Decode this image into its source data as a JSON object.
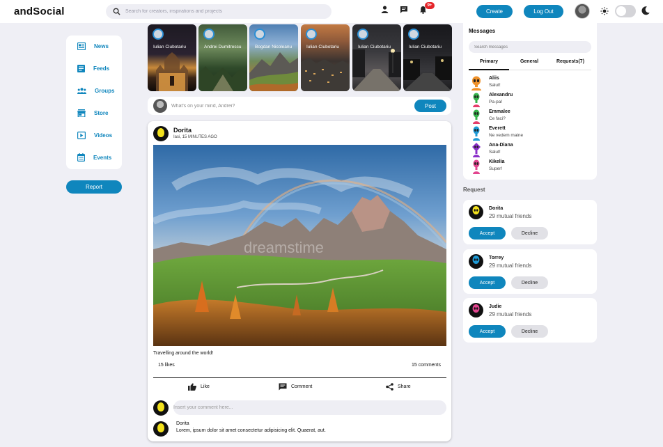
{
  "app": {
    "logo": "andSocial"
  },
  "search": {
    "placeholder": "Search for creators, inspirations and projects"
  },
  "header": {
    "notification_badge": "9+",
    "create_label": "Create",
    "logout_label": "Log Out"
  },
  "nav": {
    "items": [
      {
        "label": "News",
        "icon": "news-icon"
      },
      {
        "label": "Feeds",
        "icon": "feeds-icon"
      },
      {
        "label": "Groups",
        "icon": "groups-icon"
      },
      {
        "label": "Store",
        "icon": "store-icon"
      },
      {
        "label": "Videos",
        "icon": "videos-icon"
      },
      {
        "label": "Events",
        "icon": "events-icon"
      }
    ],
    "report_label": "Report"
  },
  "stories": [
    {
      "name": "Iulian Ciubotariu"
    },
    {
      "name": "Andrei Dumitrescu"
    },
    {
      "name": "Bogdan Nicoleanu"
    },
    {
      "name": "Iulian Ciubotariu"
    },
    {
      "name": "Iulian Ciubotariu"
    },
    {
      "name": "Iulian Ciubotariu"
    }
  ],
  "composer": {
    "placeholder": "What's on your mind, Andrei?",
    "post_label": "Post"
  },
  "post": {
    "author": "Dorita",
    "location": "Iasi, 15 MINUTES AGO",
    "watermark": "dreamstime",
    "caption": "Travelling around the world!",
    "likes": "15 likes",
    "comments": "15 comments",
    "actions": {
      "like": "Like",
      "comment": "Comment",
      "share": "Share"
    },
    "comment_placeholder": "Insert your comment here...",
    "comment": {
      "author": "Dorita",
      "text": "Lorem, ipsum dolor sit amet consectetur adipisicing elit. Quaerat, aut."
    }
  },
  "messages": {
    "title": "Messages",
    "search_placeholder": "Search messages",
    "tabs": [
      "Primary",
      "General",
      "Requests(7)"
    ],
    "list": [
      {
        "name": "Aliis",
        "text": "Salut!",
        "color": "#f0922a"
      },
      {
        "name": "Alexandru",
        "text": "Pa-pa!",
        "color": "#34b34a"
      },
      {
        "name": "Emmalee",
        "text": "Ce faci?",
        "color": "#e53d6b"
      },
      {
        "name": "Everett",
        "text": "Ne vedem maine",
        "color": "#1e9ad6"
      },
      {
        "name": "Ana-Diana",
        "text": "Salut!",
        "color": "#8b2fc9"
      },
      {
        "name": "Kikelia",
        "text": "Super!",
        "color": "#e2458f"
      }
    ]
  },
  "requests": {
    "title": "Request",
    "accept_label": "Accept",
    "decline_label": "Decline",
    "items": [
      {
        "name": "Dorita",
        "mutual": "29 mutual friends",
        "color": "#f2e11d"
      },
      {
        "name": "Torrey",
        "mutual": "29 mutual friends",
        "color": "#1e9ad6"
      },
      {
        "name": "Judie",
        "mutual": "29 mutual friends",
        "color": "#e2458f"
      }
    ]
  }
}
